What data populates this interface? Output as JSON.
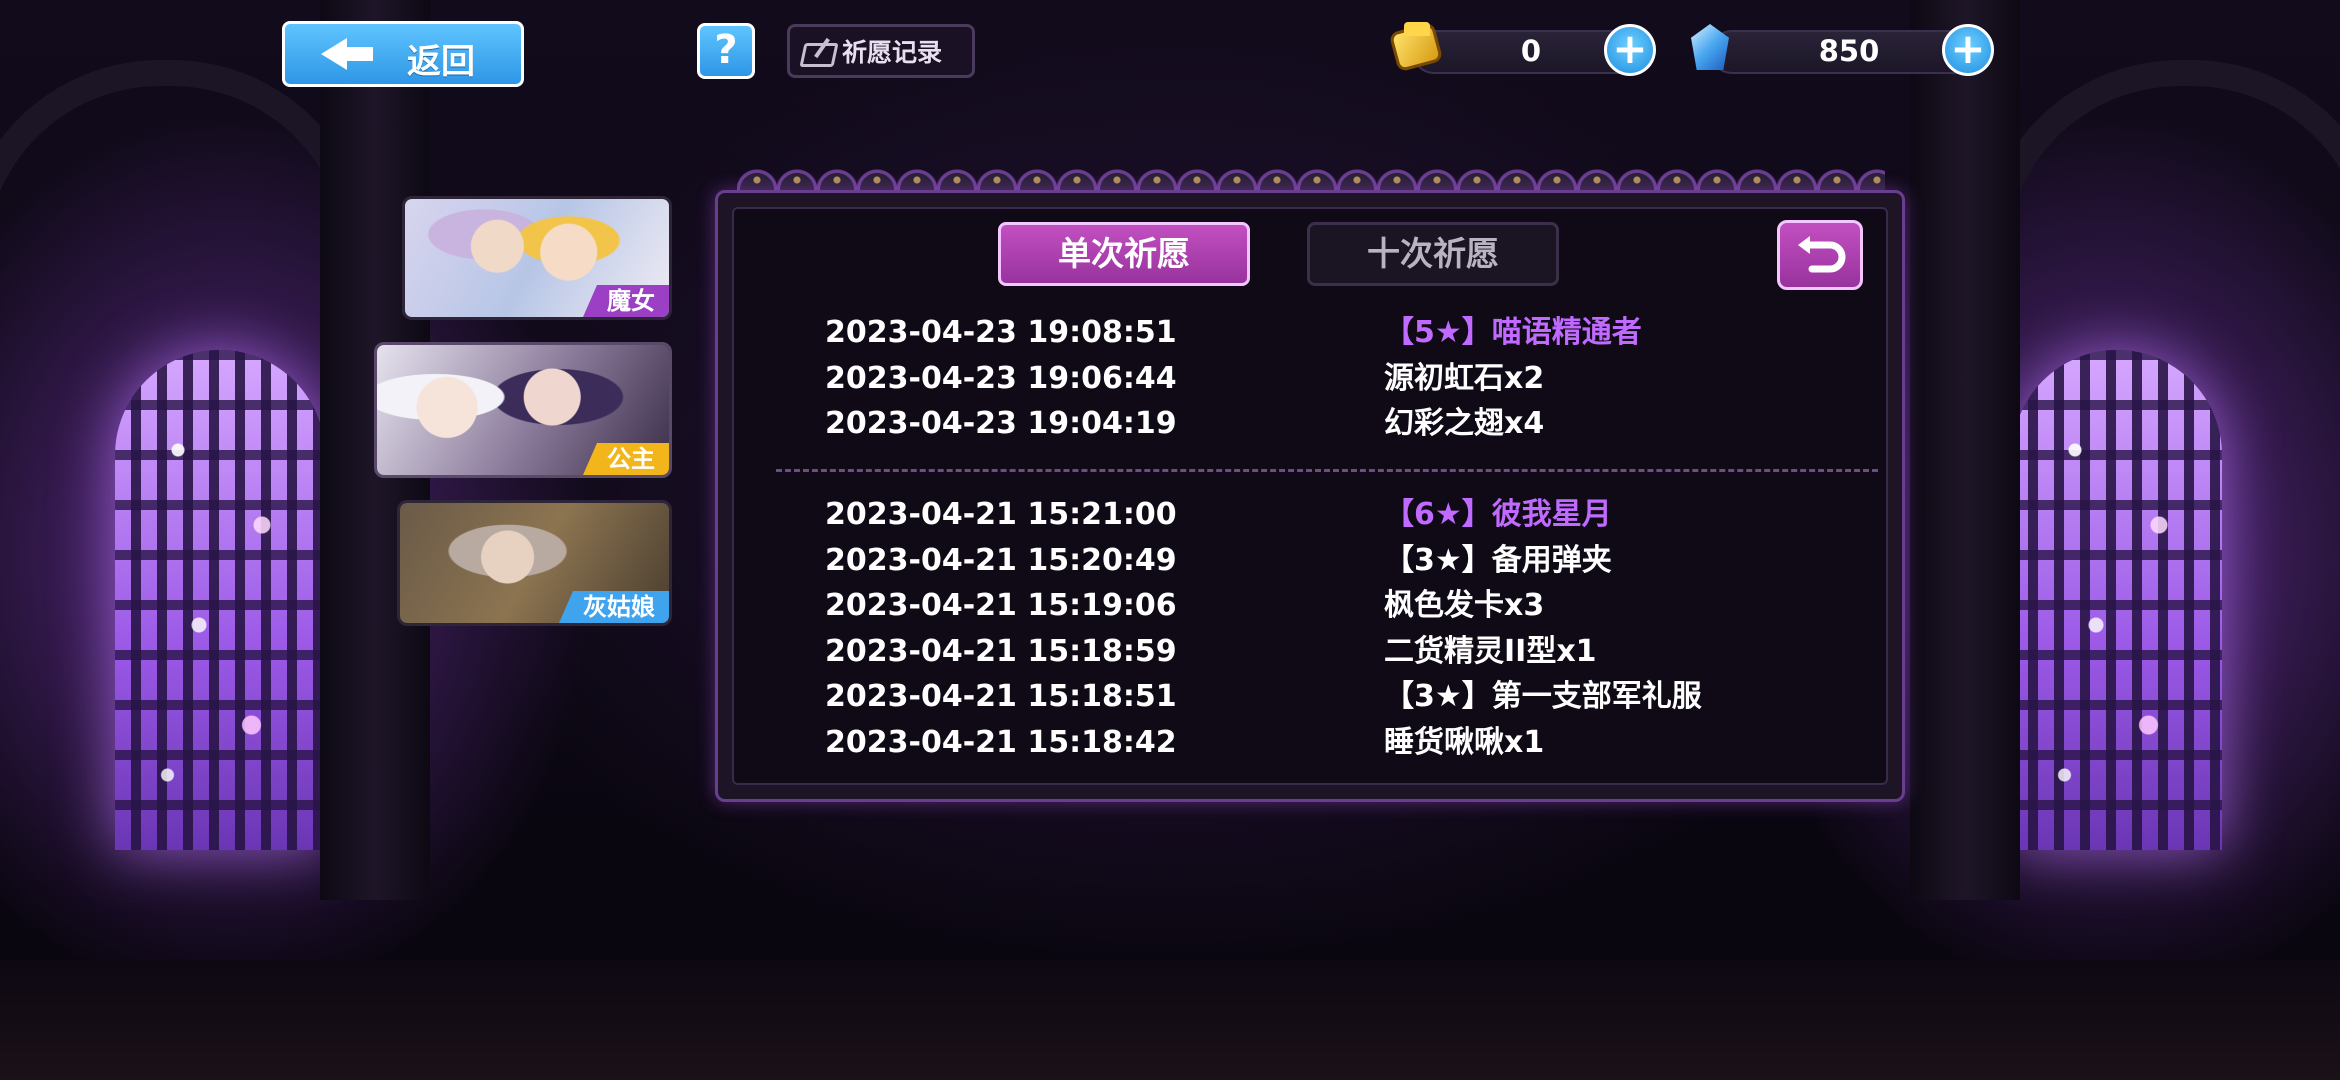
{
  "topbar": {
    "back_label": "返回",
    "help_label": "?",
    "record_label": "祈愿记录"
  },
  "currencies": [
    {
      "icon": "ticket-icon",
      "value": "0"
    },
    {
      "icon": "gem-icon",
      "value": "850"
    }
  ],
  "character_tabs": [
    {
      "label": "魔女",
      "label_color": "#9b3fc4"
    },
    {
      "label": "公主",
      "label_color": "#f2b51c"
    },
    {
      "label": "灰姑娘",
      "label_color": "#3fa3ee"
    }
  ],
  "panel": {
    "tab_single": "单次祈愿",
    "tab_ten": "十次祈愿",
    "highlight_color": "#c06aff"
  },
  "record_groups": [
    [
      {
        "date": "2023-04-23 19:08:51",
        "item": "【5★】喵语精通者",
        "highlight": true
      },
      {
        "date": "2023-04-23 19:06:44",
        "item": "源初虹石x2",
        "highlight": false
      },
      {
        "date": "2023-04-23 19:04:19",
        "item": "幻彩之翅x4",
        "highlight": false
      }
    ],
    [
      {
        "date": "2023-04-21 15:21:00",
        "item": "【6★】彼我星月",
        "highlight": true
      },
      {
        "date": "2023-04-21 15:20:49",
        "item": "【3★】备用弹夹",
        "highlight": false
      },
      {
        "date": "2023-04-21 15:19:06",
        "item": "枫色发卡x3",
        "highlight": false
      },
      {
        "date": "2023-04-21 15:18:59",
        "item": "二货精灵II型x1",
        "highlight": false
      },
      {
        "date": "2023-04-21 15:18:51",
        "item": "【3★】第一支部军礼服",
        "highlight": false
      },
      {
        "date": "2023-04-21 15:18:42",
        "item": "睡货啾啾x1",
        "highlight": false
      }
    ]
  ]
}
